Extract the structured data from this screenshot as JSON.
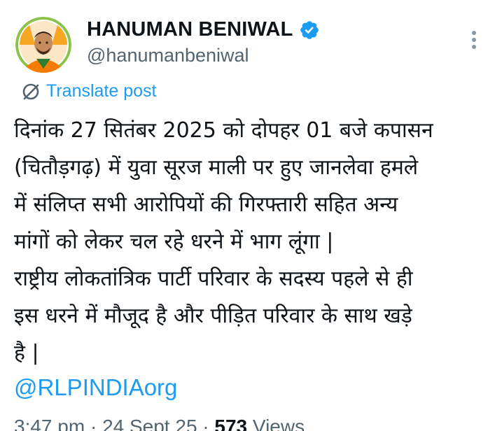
{
  "author": {
    "display_name": "HANUMAN BENIWAL",
    "handle": "@hanumanbeniwal",
    "verified": true
  },
  "icons": {
    "verified": "verified-badge-icon",
    "more": "more-vertical-icon",
    "translate": "translate-icon"
  },
  "colors": {
    "accent": "#1d9bf0",
    "text": "#0f1419",
    "muted": "#536471",
    "avatar_ring": "#8bc34a"
  },
  "translate_label": "Translate post",
  "tweet": {
    "lines": [
      "दिनांक 27 सितंबर 2025 को दोपहर 01 बजे कपासन",
      "(चितौड़गढ़) में युवा सूरज माली पर हुए जानलेवा हमले",
      "में संलिप्त सभी आरोपियों की गिरफ्तारी सहित अन्य",
      "मांगों को लेकर चल रहे धरने में भाग लूंगा |",
      "राष्ट्रीय लोकतांत्रिक पार्टी परिवार के सदस्य पहले से ही",
      "इस धरने में मौजूद है और पीड़ित परिवार के साथ खड़े",
      "है |"
    ],
    "mention": "@RLPINDIAorg"
  },
  "meta": {
    "time": "3:47 pm",
    "separator": " · ",
    "date": "24 Sept 25",
    "views_count": "573",
    "views_label": " Views"
  }
}
